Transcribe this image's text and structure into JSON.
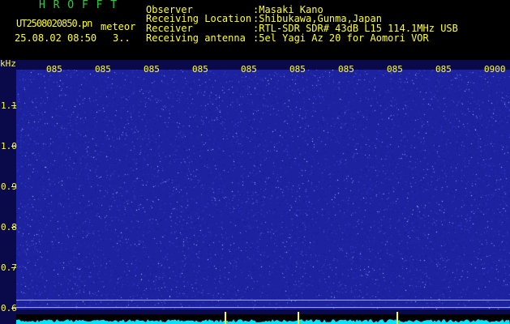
{
  "header": {
    "app_title": "H R O F F T",
    "file_name": "UT2508020850.pn",
    "file_tag": "meteor",
    "datetime": "25.08.02 08:50",
    "count": "3..",
    "meta": [
      {
        "label": "Observer",
        "value": ":Masaki Kano"
      },
      {
        "label": "Receiving Location",
        "value": ":Shibukawa,Gunma,Japan"
      },
      {
        "label": "Receiver",
        "value": ":RTL-SDR SDR# 43dB L15 114.1MHz USB"
      },
      {
        "label": "Receiving antenna",
        "value": ":5el Yagi Az 20 for Aomori VOR"
      }
    ]
  },
  "waterfall": {
    "unit": "kHz",
    "time_ticks": [
      "085",
      "085",
      "085",
      "085",
      "085",
      "085",
      "085",
      "085",
      "085",
      "0900"
    ],
    "y_labels": [
      "1.1",
      "1.0",
      "0.9",
      "0.8",
      "0.7",
      "0.6"
    ],
    "colors": {
      "background": "#1d23a0",
      "noise": "#8c96ff",
      "axis": "#ffff2a",
      "spectrum": "#00e5ff"
    }
  }
}
